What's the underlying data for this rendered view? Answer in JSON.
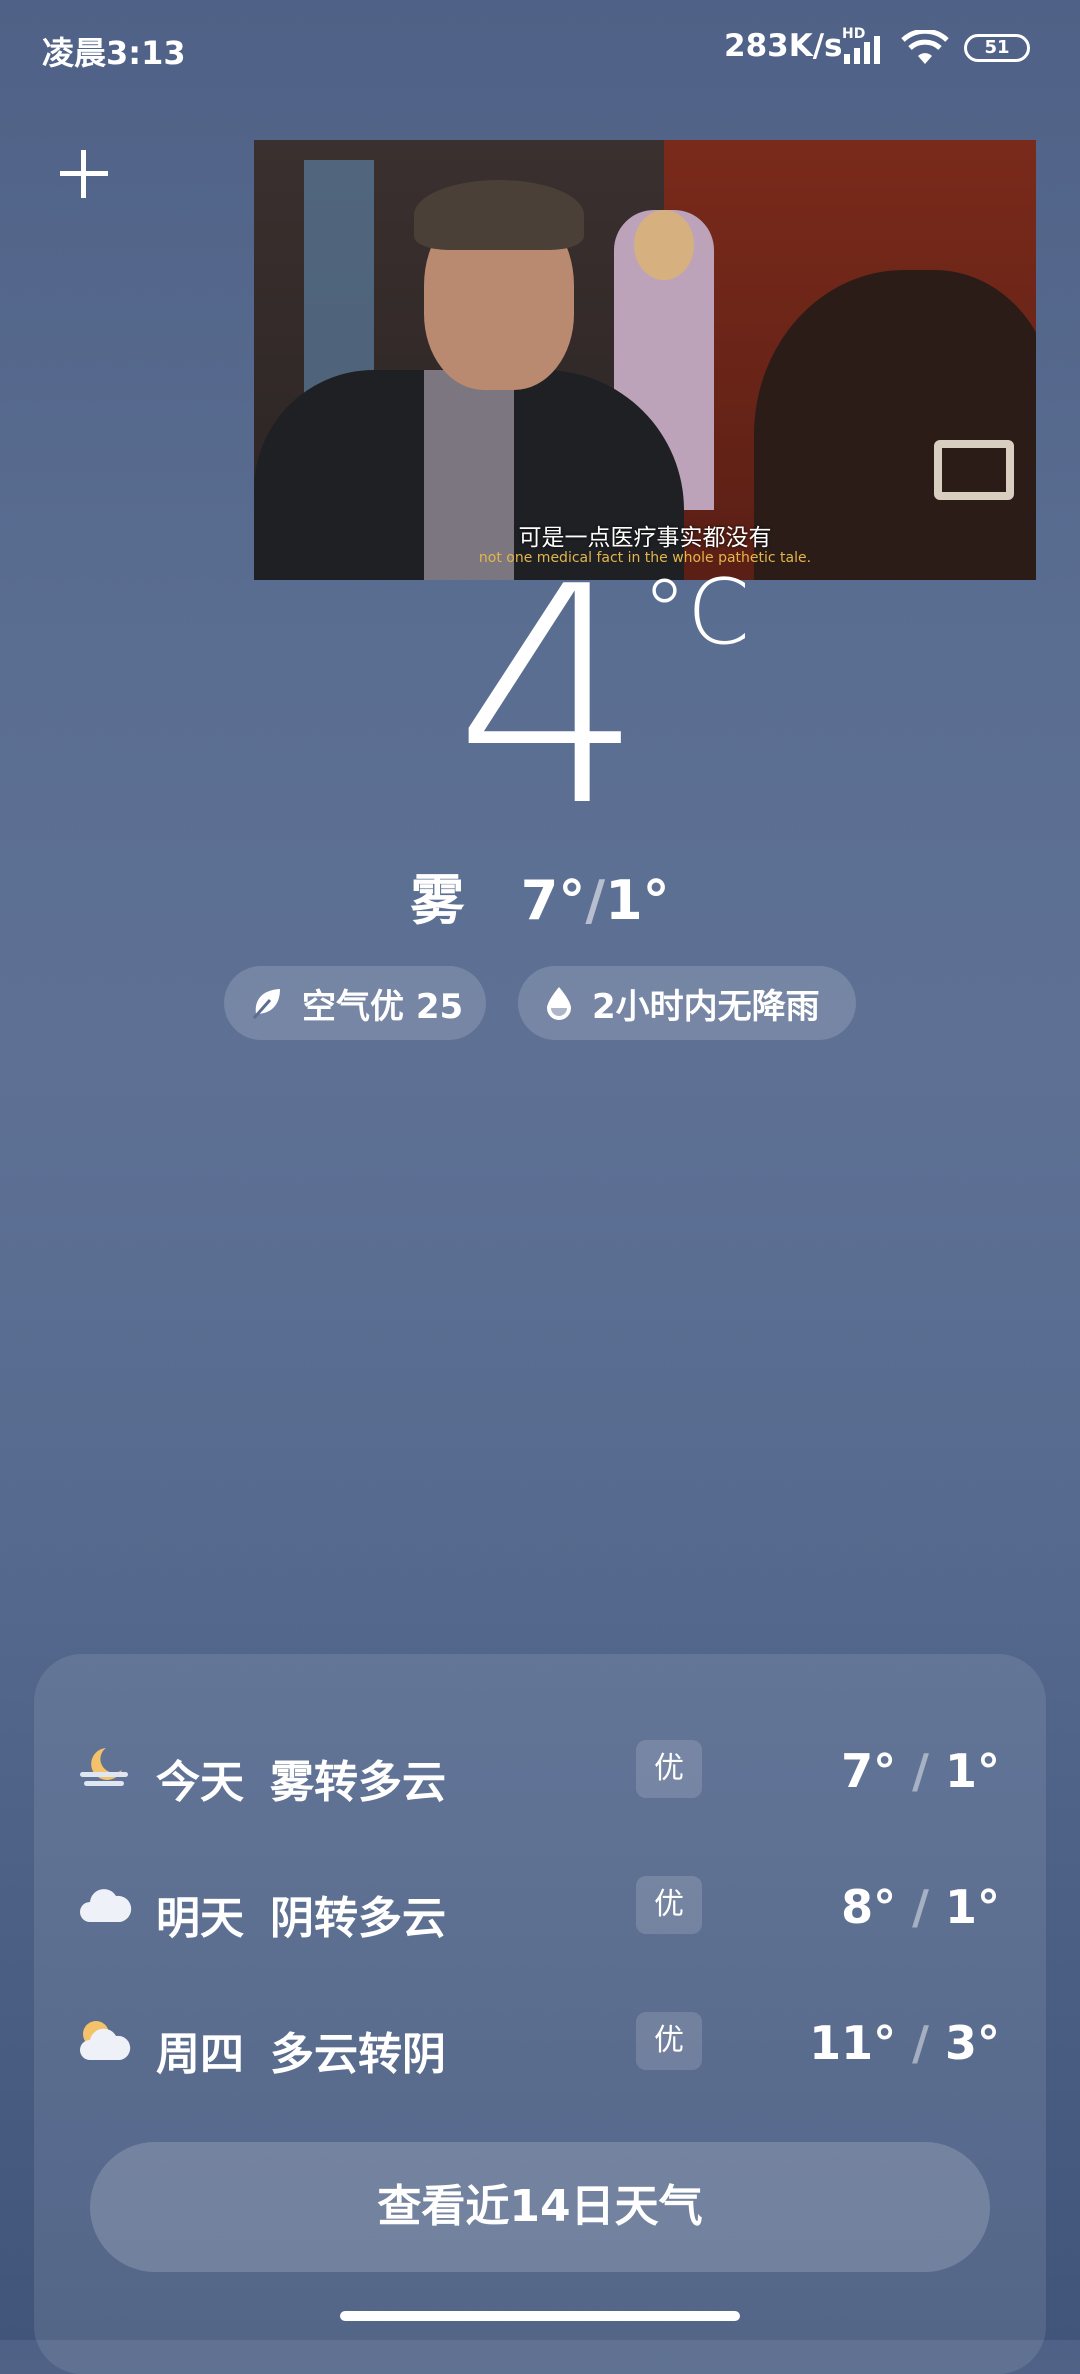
{
  "status_bar": {
    "time": "凌晨3:13",
    "net_speed": "283K/s",
    "hd": "HD",
    "battery": "51",
    "icons": [
      "signal-icon",
      "wifi-icon",
      "battery-icon"
    ]
  },
  "video": {
    "subtitle_cn": "可是一点医疗事实都没有",
    "subtitle_en": "not one medical fact in the whole pathetic tale."
  },
  "weather": {
    "temperature": "4",
    "unit": "°C",
    "condition": "雾",
    "high": "7°",
    "low": "1°",
    "air_quality": "空气优 25",
    "rain": "2小时内无降雨"
  },
  "forecast": [
    {
      "day": "今天",
      "desc": "雾转多云",
      "aqi": "优",
      "high": "7°",
      "low": "1°",
      "icon": "moon-fog-icon"
    },
    {
      "day": "明天",
      "desc": "阴转多云",
      "aqi": "优",
      "high": "8°",
      "low": "1°",
      "icon": "cloud-icon"
    },
    {
      "day": "周四",
      "desc": "多云转阴",
      "aqi": "优",
      "high": "11°",
      "low": "3°",
      "icon": "partly-cloudy-icon"
    }
  ],
  "more_button": "查看近14日天气",
  "colors": {
    "accent_sun": "#f3c26a",
    "bg_top": "#4f6186",
    "bg_bottom": "#41557b"
  }
}
